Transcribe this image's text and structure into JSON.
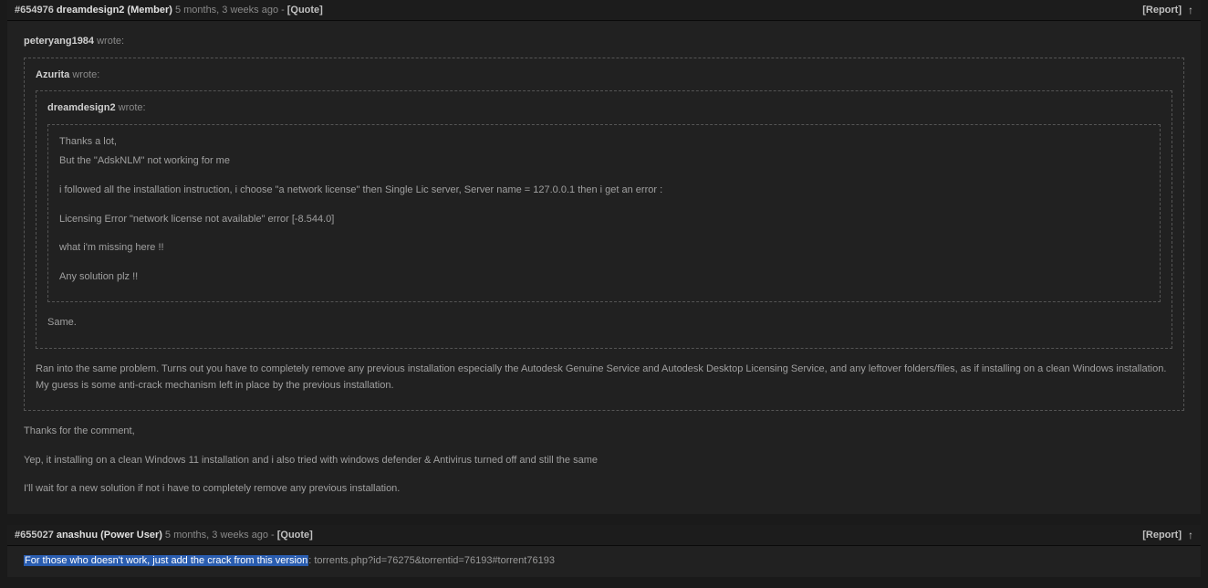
{
  "posts": [
    {
      "id": "#654976",
      "username": "dreamdesign2",
      "rank": "(Member)",
      "time": "5 months, 3 weeks ago",
      "dash": " - ",
      "quote": "[Quote]",
      "report": "[Report]",
      "q1": {
        "user": "peteryang1984",
        "wrote": " wrote:"
      },
      "q2": {
        "user": "Azurita",
        "wrote": " wrote:"
      },
      "q3": {
        "user": "dreamdesign2",
        "wrote": " wrote:"
      },
      "innermost": {
        "l1": "Thanks a lot,",
        "l2": "But the \"AdskNLM\" not working for me",
        "l3": "i followed all the installation instruction, i choose \"a network license\" then Single Lic server, Server name = 127.0.0.1 then i get an error :",
        "l4": "Licensing Error \"network license not available\" error [-8.544.0]",
        "l5": "what i'm missing here !!",
        "l6": "Any solution plz !!"
      },
      "q2_body": "Same.",
      "q1_body": "Ran into the same problem. Turns out you have to completely remove any previous installation especially the Autodesk Genuine Service and Autodesk Desktop Licensing Service, and any leftover folders/files, as if installing on a clean Windows installation. My guess is some anti-crack mechanism left in place by the previous installation.",
      "reply": {
        "l1": "Thanks for the comment,",
        "l2": "Yep, it installing on a clean Windows 11 installation and i also tried with windows defender & Antivirus turned off and still the same",
        "l3": "I'll wait for a new solution if not i have to completely remove any previous installation."
      }
    },
    {
      "id": "#655027",
      "username": "anashuu",
      "rank": "(Power User)",
      "time": "5 months, 3 weeks ago",
      "dash": " - ",
      "quote": "[Quote]",
      "report": "[Report]",
      "highlighted": "For those who doesn't work, just add the crack from this version",
      "rest": ": torrents.php?id=76275&torrentid=76193#torrent76193"
    }
  ]
}
